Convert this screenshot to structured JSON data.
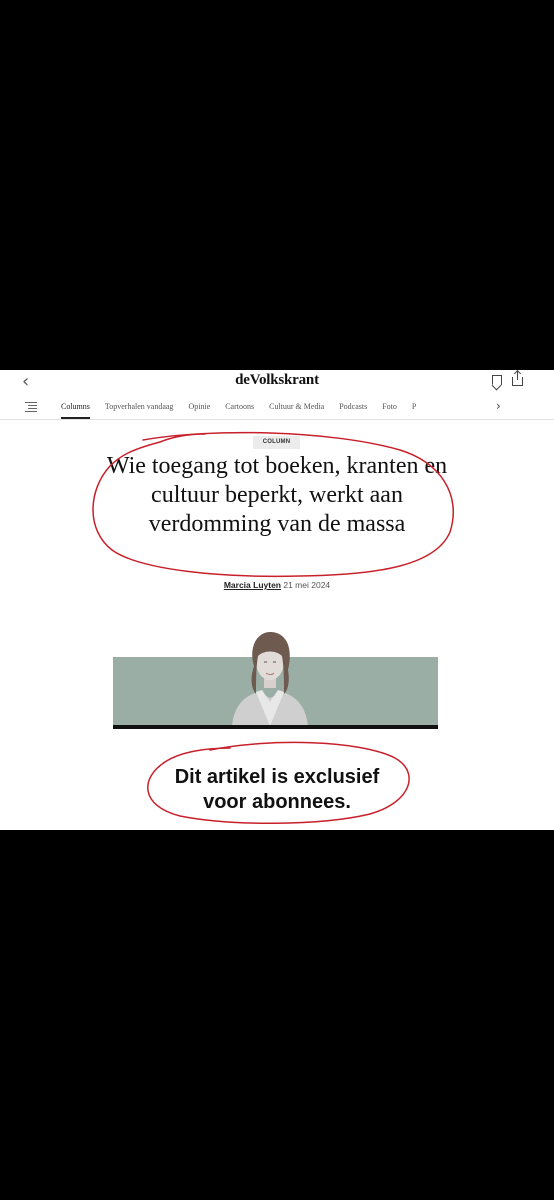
{
  "header": {
    "logo": "deVolkskrant",
    "back_icon": "chevron-left-icon",
    "bookmark_icon": "bookmark-icon",
    "share_icon": "share-icon"
  },
  "nav": {
    "tabs": [
      {
        "label": "Columns",
        "active": true
      },
      {
        "label": "Topverhalen vandaag"
      },
      {
        "label": "Opinie"
      },
      {
        "label": "Cartoons"
      },
      {
        "label": "Cultuur & Media"
      },
      {
        "label": "Podcasts"
      },
      {
        "label": "Foto"
      },
      {
        "label": "P"
      }
    ],
    "next_icon": "chevron-right-icon",
    "menu_icon": "menu-icon"
  },
  "article": {
    "badge": "COLUMN",
    "headline": "Wie toegang tot boeken, kranten en cultuur beperkt, werkt aan verdomming van de massa",
    "author": "Marcia Luyten",
    "date": "21 mei 2024"
  },
  "paywall": {
    "line1": "Dit artikel is exclusief",
    "line2": "voor abonnees."
  },
  "colors": {
    "frame": "#000000",
    "photo_band": "#9aaea6",
    "annotation": "#c8202a"
  }
}
